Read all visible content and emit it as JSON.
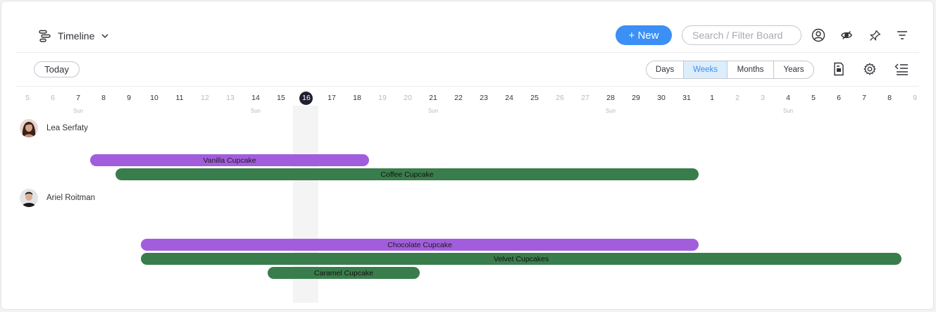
{
  "board": {
    "view_name": "Timeline"
  },
  "toolbar": {
    "new_label": "+ New",
    "search_placeholder": "Search / Filter Board"
  },
  "controls": {
    "today_label": "Today",
    "scales": [
      "Days",
      "Weeks",
      "Months",
      "Years"
    ],
    "active_scale": "Weeks"
  },
  "timeline": {
    "days": [
      {
        "label": "5",
        "weekend": true
      },
      {
        "label": "6",
        "weekend": true
      },
      {
        "label": "7"
      },
      {
        "label": "8"
      },
      {
        "label": "9"
      },
      {
        "label": "10"
      },
      {
        "label": "11"
      },
      {
        "label": "12",
        "weekend": true
      },
      {
        "label": "13",
        "weekend": true
      },
      {
        "label": "14"
      },
      {
        "label": "15"
      },
      {
        "label": "16",
        "today": true
      },
      {
        "label": "17"
      },
      {
        "label": "18"
      },
      {
        "label": "19",
        "weekend": true
      },
      {
        "label": "20",
        "weekend": true
      },
      {
        "label": "21"
      },
      {
        "label": "22"
      },
      {
        "label": "23"
      },
      {
        "label": "24"
      },
      {
        "label": "25"
      },
      {
        "label": "26",
        "weekend": true
      },
      {
        "label": "27",
        "weekend": true
      },
      {
        "label": "28"
      },
      {
        "label": "29"
      },
      {
        "label": "30"
      },
      {
        "label": "31"
      },
      {
        "label": "1"
      },
      {
        "label": "2",
        "weekend": true
      },
      {
        "label": "3",
        "weekend": true
      },
      {
        "label": "4"
      },
      {
        "label": "5"
      },
      {
        "label": "6"
      },
      {
        "label": "7"
      },
      {
        "label": "8"
      },
      {
        "label": "9",
        "weekend": true
      }
    ],
    "week_marker_label": "Sun"
  },
  "groups": [
    {
      "person": "Lea Serfaty",
      "avatar": "woman-avatar"
    },
    {
      "person": "Ariel Roitman",
      "avatar": "man-avatar"
    }
  ],
  "items": [
    {
      "name": "Vanilla Cupcake",
      "color": "#a25ddc"
    },
    {
      "name": "Coffee Cupcake",
      "color": "#3a7d4d"
    },
    {
      "name": "Chocolate Cupcake",
      "color": "#a25ddc"
    },
    {
      "name": "Velvet Cupcakes",
      "color": "#3a7d4d"
    },
    {
      "name": "Caramel Cupcake",
      "color": "#3a7d4d"
    }
  ]
}
